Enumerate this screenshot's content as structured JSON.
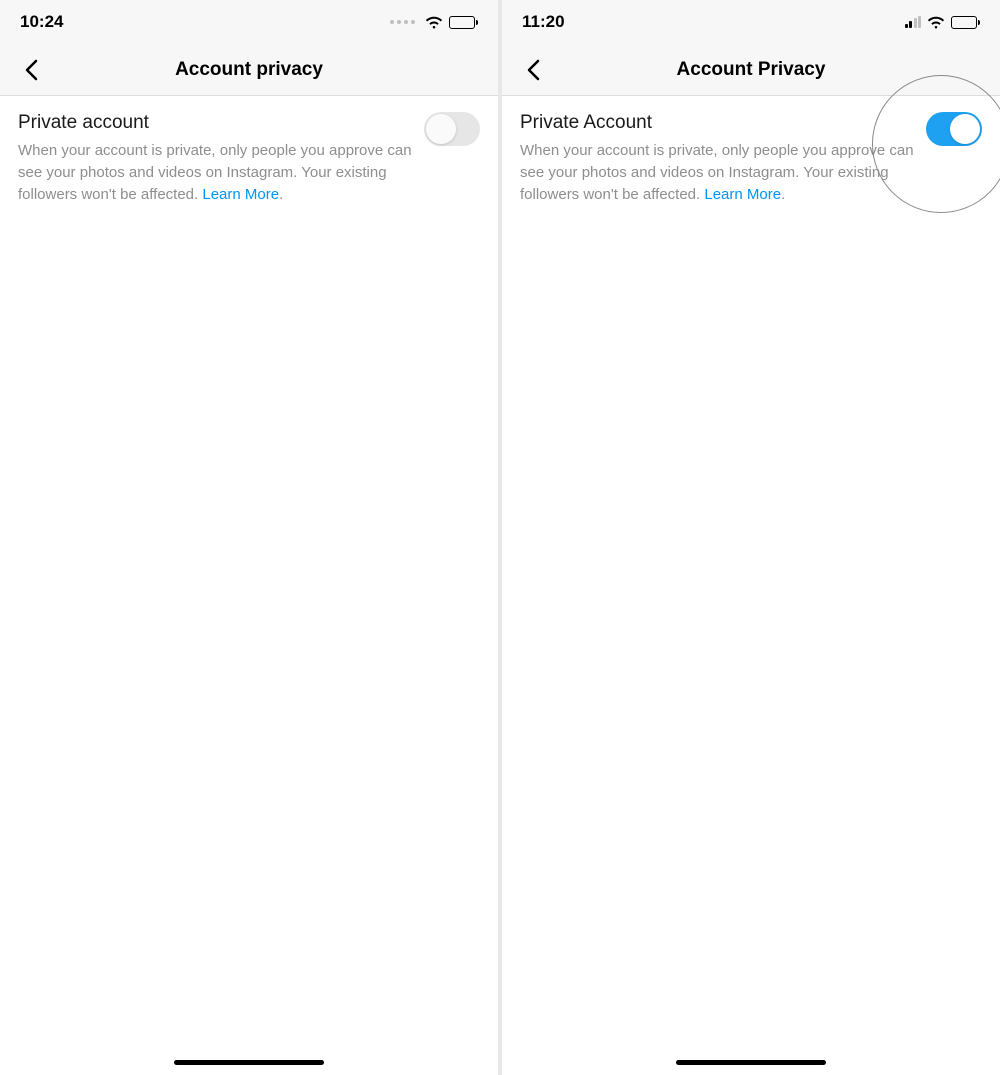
{
  "left": {
    "status": {
      "time": "10:24"
    },
    "nav": {
      "title": "Account privacy"
    },
    "setting": {
      "title": "Private account",
      "description_pre": "When your account is private, only people you approve can see your photos and videos on Instagram. Your existing followers won't be affected. ",
      "learn_more": "Learn More",
      "dot": ".",
      "toggle_on": false
    }
  },
  "right": {
    "status": {
      "time": "11:20"
    },
    "nav": {
      "title": "Account Privacy"
    },
    "setting": {
      "title": "Private Account",
      "description_pre": "When your account is private, only people you approve can see your photos and videos on Instagram. Your existing followers won't be affected. ",
      "learn_more": "Learn More",
      "dot": ".",
      "toggle_on": true
    }
  },
  "icons": {
    "back": "back-chevron-icon",
    "wifi": "wifi-icon",
    "battery": "battery-icon",
    "signal": "cellular-signal-icon"
  },
  "colors": {
    "link": "#0095f6",
    "toggle_on": "#1fa1f1",
    "toggle_off": "#e6e6e6",
    "text_secondary": "#8e8e8e"
  }
}
